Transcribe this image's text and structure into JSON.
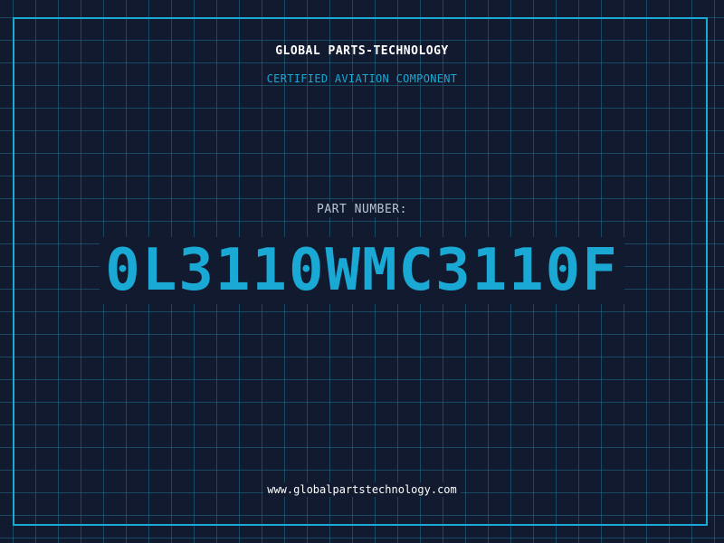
{
  "header": {
    "company": "GLOBAL PARTS-TECHNOLOGY",
    "subtitle": "CERTIFIED AVIATION COMPONENT"
  },
  "part": {
    "label": "PART NUMBER:",
    "number": "0L3110WMC3110F"
  },
  "footer": {
    "url": "www.globalpartstechnology.com"
  },
  "colors": {
    "background": "#111a2e",
    "accent": "#1aa8d4",
    "grid": "#1e6e8c",
    "text": "#ffffff"
  }
}
